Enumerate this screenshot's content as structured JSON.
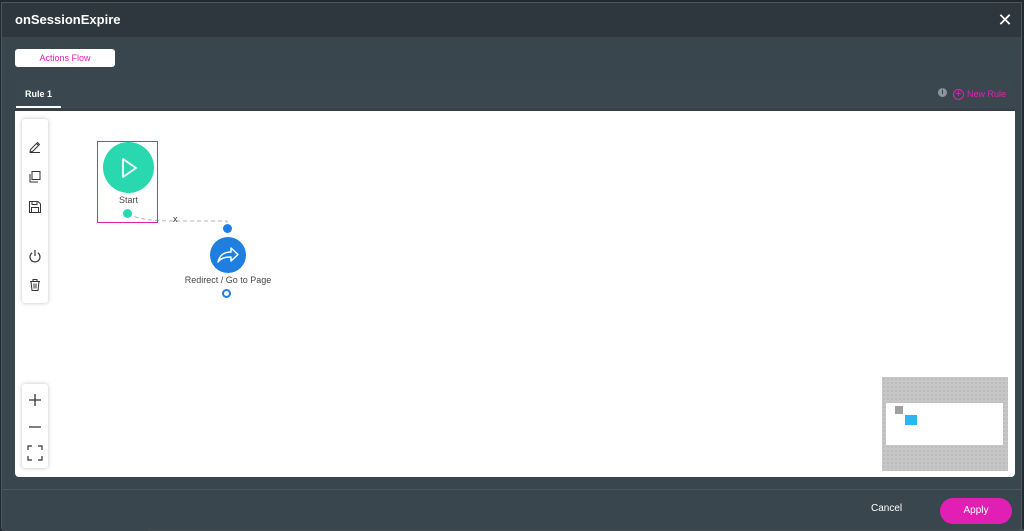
{
  "dialog": {
    "title": "onSessionExpire",
    "close_icon": "close-icon"
  },
  "tabs": {
    "actions_flow": "Actions Flow"
  },
  "rules": {
    "tabs": [
      "Rule 1"
    ],
    "new_rule_label": "New Rule",
    "info_icon_glyph": "i"
  },
  "toolbar": {
    "tools": [
      "pencil-icon",
      "copy-icon",
      "save-icon",
      "power-icon",
      "trash-icon"
    ]
  },
  "zoom": {
    "tools": [
      "zoom-in-icon",
      "zoom-out-icon",
      "fit-screen-icon"
    ]
  },
  "flow": {
    "start_label": "Start",
    "redirect_label": "Redirect / Go to Page",
    "connector_delete": "x",
    "colors": {
      "start": "#2ad8b0",
      "redirect": "#1e7fe0",
      "selection": "#e21fb5"
    }
  },
  "footer": {
    "cancel_label": "Cancel",
    "apply_label": "Apply"
  },
  "theme": {
    "accent": "#e21fb5"
  }
}
